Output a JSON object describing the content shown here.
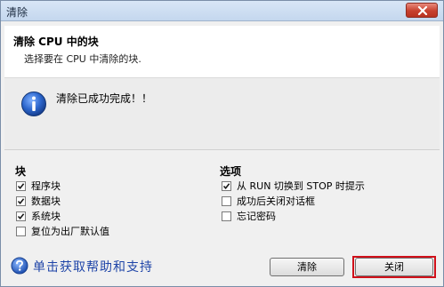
{
  "window": {
    "title": "清除"
  },
  "header": {
    "title": "清除 CPU 中的块",
    "subtitle": "选择要在 CPU 中清除的块."
  },
  "message": {
    "text": "清除已成功完成！！"
  },
  "blocks": {
    "label": "块",
    "items": [
      {
        "label": "程序块",
        "checked": true
      },
      {
        "label": "数据块",
        "checked": true
      },
      {
        "label": "系统块",
        "checked": true
      },
      {
        "label": "复位为出厂默认值",
        "checked": false
      }
    ]
  },
  "options": {
    "label": "选项",
    "items": [
      {
        "label": "从 RUN 切换到 STOP 时提示",
        "checked": true
      },
      {
        "label": "成功后关闭对话框",
        "checked": false
      },
      {
        "label": "忘记密码",
        "checked": false
      }
    ]
  },
  "help": {
    "text": "单击获取帮助和支持"
  },
  "buttons": {
    "clear_label": "清除",
    "close_label": "关闭"
  },
  "colors": {
    "accent_highlight": "#d0101a",
    "help_link": "#1f45a8"
  }
}
